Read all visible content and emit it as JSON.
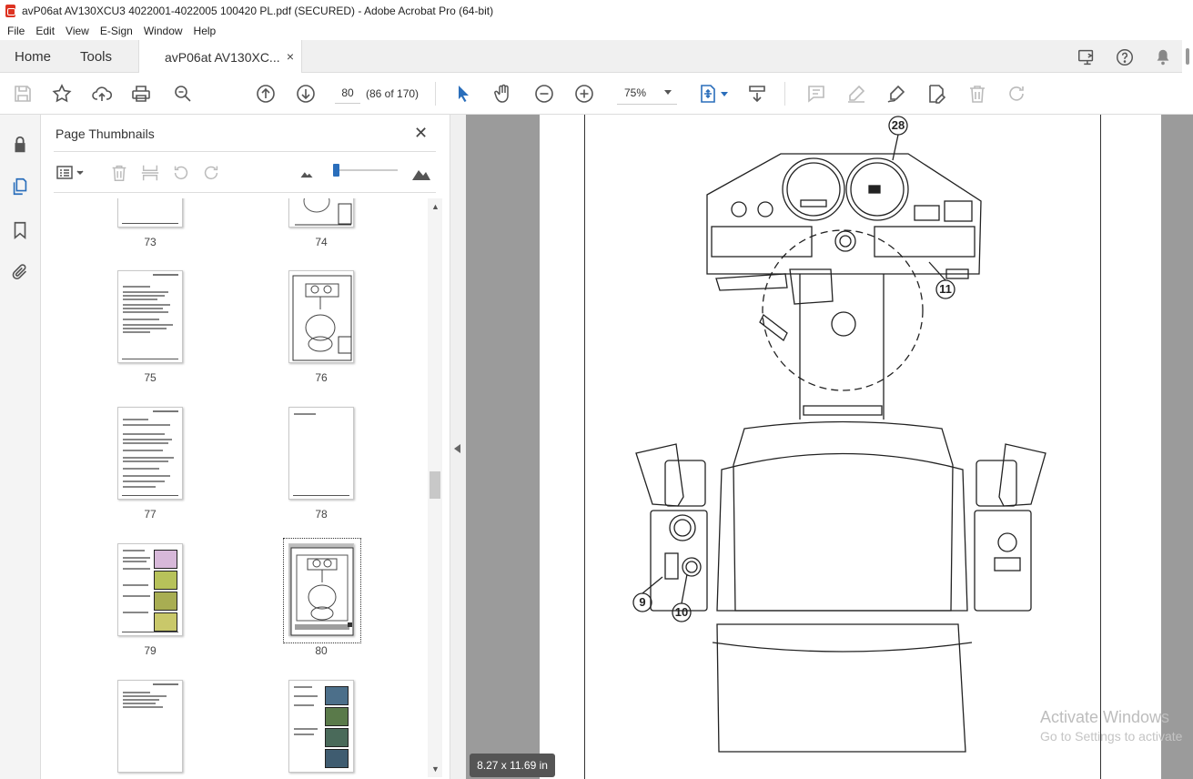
{
  "window": {
    "title": "avP06at AV130XCU3 4022001-4022005 100420 PL.pdf (SECURED) - Adobe Acrobat Pro (64-bit)"
  },
  "menu": [
    "File",
    "Edit",
    "View",
    "E-Sign",
    "Window",
    "Help"
  ],
  "tabs": {
    "home": "Home",
    "tools": "Tools",
    "document": "avP06at AV130XC...",
    "close_glyph": "×"
  },
  "toolbar": {
    "page_number": "80",
    "page_count": "(86 of 170)",
    "zoom": "75%"
  },
  "panel": {
    "title": "Page Thumbnails",
    "close_glyph": "✕",
    "thumbnails": [
      {
        "label": "73"
      },
      {
        "label": "74"
      },
      {
        "label": "75"
      },
      {
        "label": "76"
      },
      {
        "label": "77"
      },
      {
        "label": "78"
      },
      {
        "label": "79"
      },
      {
        "label": "80"
      },
      {
        "label": ""
      },
      {
        "label": ""
      }
    ],
    "thumbnail_zoom": 0.05
  },
  "viewer": {
    "page_size": "8.27 x 11.69 in",
    "callouts": [
      "28",
      "11",
      "9",
      "10"
    ]
  },
  "watermark": {
    "line1": "Activate Windows",
    "line2": "Go to Settings to activate"
  },
  "colors": {
    "accent": "#2a6ebb",
    "viewer_bg": "#9b9b9b"
  }
}
